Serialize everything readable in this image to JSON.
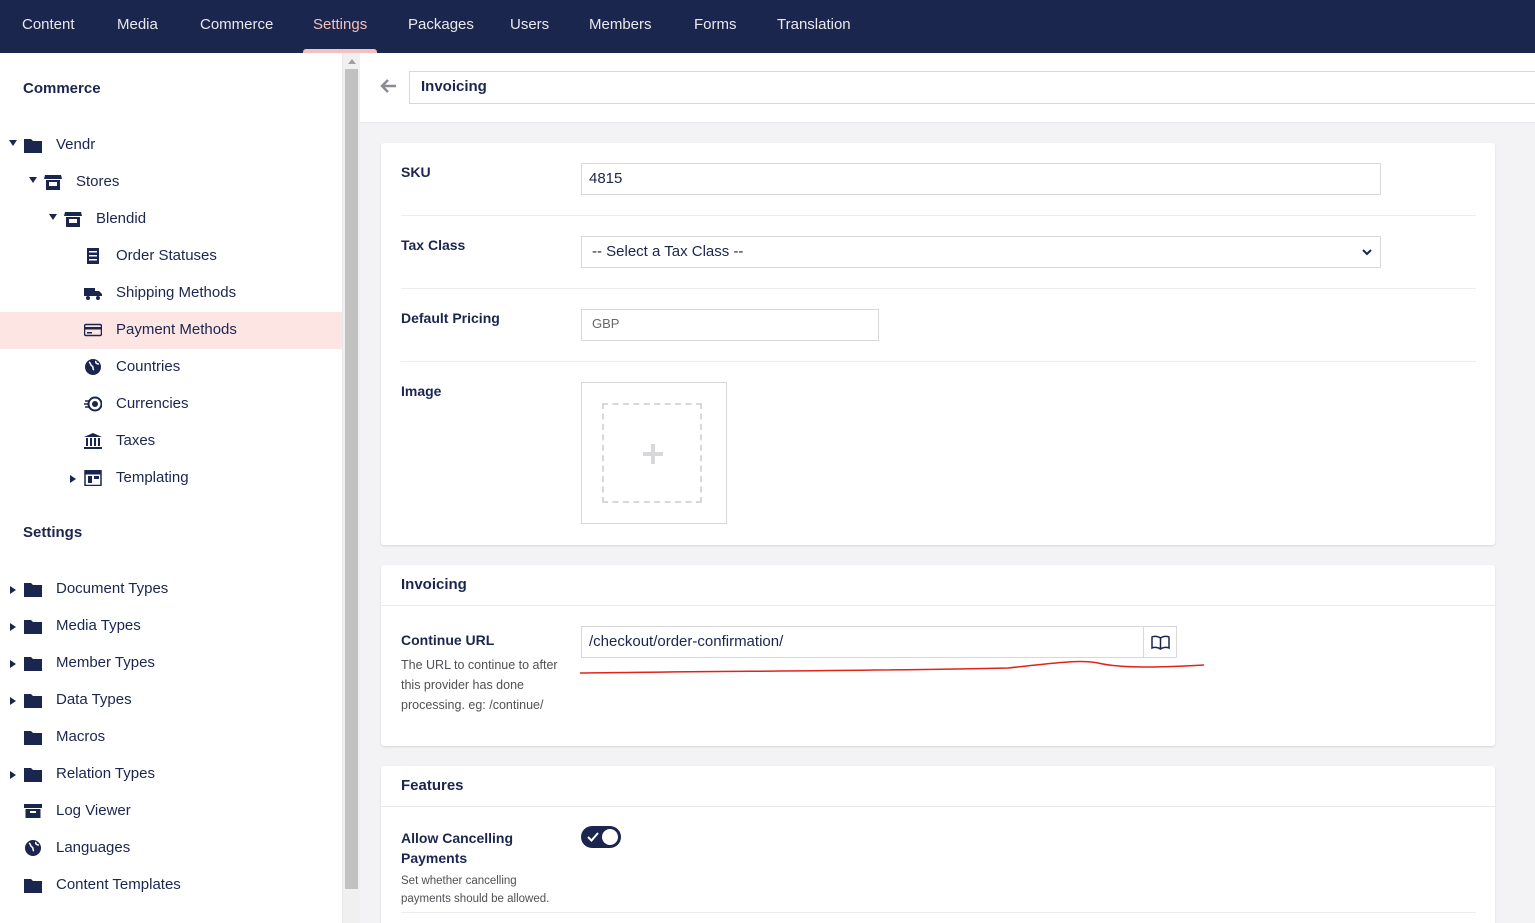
{
  "nav": {
    "tabs": [
      {
        "label": "Content"
      },
      {
        "label": "Media"
      },
      {
        "label": "Commerce"
      },
      {
        "label": "Settings"
      },
      {
        "label": "Packages"
      },
      {
        "label": "Users"
      },
      {
        "label": "Members"
      },
      {
        "label": "Forms"
      },
      {
        "label": "Translation"
      }
    ],
    "active": "Settings",
    "colors": {
      "bg": "#1b264f",
      "active": "#f5c1bc"
    }
  },
  "sidebar": {
    "commerce_title": "Commerce",
    "commerce_items": [
      {
        "label": "Vendr",
        "icon": "folder-icon"
      },
      {
        "label": "Stores",
        "icon": "store-icon"
      },
      {
        "label": "Blendid",
        "icon": "store-icon"
      },
      {
        "label": "Order Statuses",
        "icon": "receipt-icon"
      },
      {
        "label": "Shipping Methods",
        "icon": "truck-icon"
      },
      {
        "label": "Payment Methods",
        "icon": "credit-card-icon",
        "selected": true
      },
      {
        "label": "Countries",
        "icon": "globe-icon"
      },
      {
        "label": "Currencies",
        "icon": "coins-icon"
      },
      {
        "label": "Taxes",
        "icon": "bank-icon"
      },
      {
        "label": "Templating",
        "icon": "layout-icon"
      }
    ],
    "settings_title": "Settings",
    "settings_items": [
      {
        "label": "Document Types",
        "icon": "folder-icon"
      },
      {
        "label": "Media Types",
        "icon": "folder-icon"
      },
      {
        "label": "Member Types",
        "icon": "folder-icon"
      },
      {
        "label": "Data Types",
        "icon": "folder-icon"
      },
      {
        "label": "Macros",
        "icon": "folder-icon"
      },
      {
        "label": "Relation Types",
        "icon": "folder-icon"
      },
      {
        "label": "Log Viewer",
        "icon": "archive-icon"
      },
      {
        "label": "Languages",
        "icon": "globe-icon"
      },
      {
        "label": "Content Templates",
        "icon": "folder-icon"
      }
    ],
    "selected_color": "#fce5e3"
  },
  "editor": {
    "name_value": "Invoicing",
    "general": {
      "sku_label": "SKU",
      "sku_value": "4815",
      "tax_class_label": "Tax Class",
      "tax_class_value": "-- Select a Tax Class --",
      "default_pricing_label": "Default Pricing",
      "default_pricing_value": "GBP",
      "image_label": "Image"
    },
    "invoicing": {
      "title": "Invoicing",
      "continue_url_label": "Continue URL",
      "continue_url_desc": "The URL to continue to after this provider has done processing. eg: /continue/",
      "continue_url_value": "/checkout/order-confirmation/"
    },
    "features": {
      "title": "Features",
      "allow_cancel_label": "Allow Cancelling Payments",
      "allow_cancel_desc": "Set whether cancelling payments should be allowed.",
      "allow_cancel_on": true
    }
  }
}
